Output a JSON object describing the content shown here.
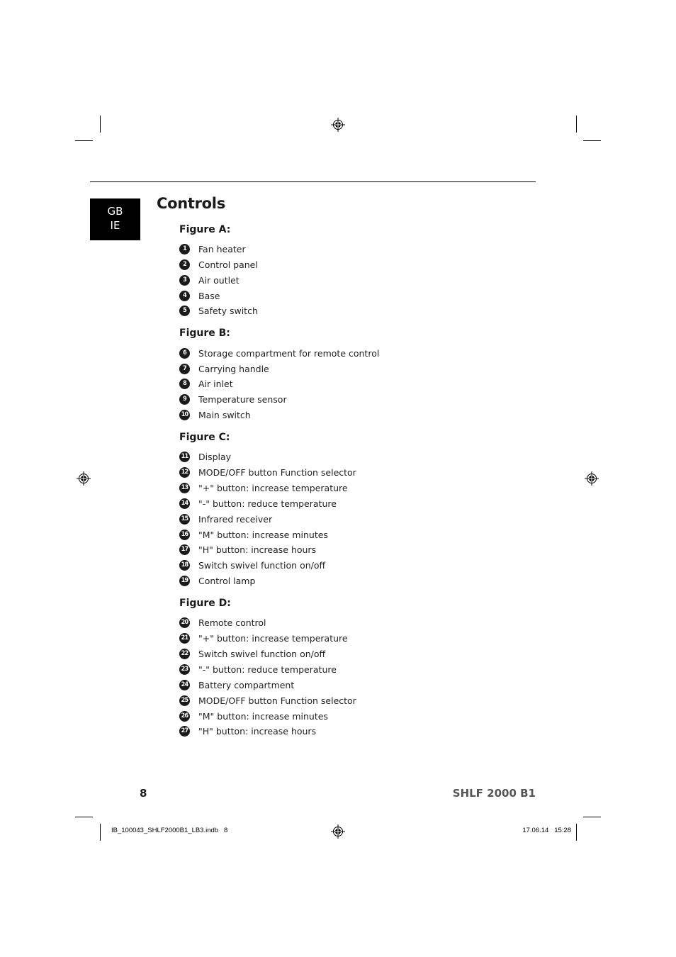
{
  "page": {
    "language_tab": [
      "GB",
      "IE"
    ],
    "title": "Controls",
    "figures": [
      {
        "heading": "Figure A:",
        "items": [
          {
            "num": "1",
            "label": "Fan heater"
          },
          {
            "num": "2",
            "label": "Control panel"
          },
          {
            "num": "3",
            "label": "Air outlet"
          },
          {
            "num": "4",
            "label": "Base"
          },
          {
            "num": "5",
            "label": "Safety switch"
          }
        ]
      },
      {
        "heading": "Figure B:",
        "items": [
          {
            "num": "6",
            "label": "Storage compartment for remote control"
          },
          {
            "num": "7",
            "label": "Carrying handle"
          },
          {
            "num": "8",
            "label": "Air inlet"
          },
          {
            "num": "9",
            "label": "Temperature sensor"
          },
          {
            "num": "10",
            "label": "Main switch"
          }
        ]
      },
      {
        "heading": "Figure C:",
        "items": [
          {
            "num": "11",
            "label": "Display"
          },
          {
            "num": "12",
            "label": "MODE/OFF button Function selector"
          },
          {
            "num": "13",
            "label": "\"+\" button: increase temperature"
          },
          {
            "num": "14",
            "label": "\"-\" button: reduce temperature"
          },
          {
            "num": "15",
            "label": "Infrared receiver"
          },
          {
            "num": "16",
            "label": "\"M\" button: increase minutes"
          },
          {
            "num": "17",
            "label": "\"H\" button: increase hours"
          },
          {
            "num": "18",
            "label": "Switch swivel function on/off"
          },
          {
            "num": "19",
            "label": "Control lamp"
          }
        ]
      },
      {
        "heading": "Figure D:",
        "items": [
          {
            "num": "20",
            "label": "Remote control"
          },
          {
            "num": "21",
            "label": "\"+\" button: increase temperature"
          },
          {
            "num": "22",
            "label": "Switch swivel function on/off"
          },
          {
            "num": "23",
            "label": "\"-\" button: reduce temperature"
          },
          {
            "num": "24",
            "label": "Battery compartment"
          },
          {
            "num": "25",
            "label": "MODE/OFF button Function selector"
          },
          {
            "num": "26",
            "label": "\"M\" button: increase minutes"
          },
          {
            "num": "27",
            "label": "\"H\" button: increase hours"
          }
        ]
      }
    ],
    "footer": {
      "page_number": "8",
      "model": "SHLF 2000 B1"
    },
    "print_slug": {
      "file": "IB_100043_SHLF2000B1_LB3.indb   8",
      "datetime": "17.06.14   15:28"
    },
    "icons": {
      "registration_mark": "crosshair-registration-icon"
    }
  }
}
